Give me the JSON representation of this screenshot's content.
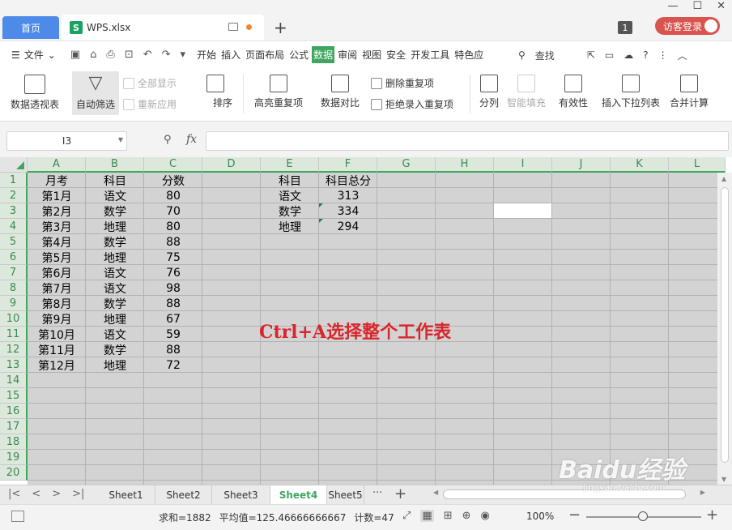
{
  "titlebar": {
    "home_tab": "首页",
    "file_tab": "WPS.xlsx",
    "file_icon": "S",
    "add_tab": "+",
    "badge": "1",
    "login": "访客登录",
    "win_min": "—",
    "win_max": "☐",
    "win_close": "✕"
  },
  "menubar": {
    "file": "文件",
    "tabs": [
      "开始",
      "插入",
      "页面布局",
      "公式",
      "数据",
      "审阅",
      "视图",
      "安全",
      "开发工具",
      "特色应"
    ],
    "active_tab": "数据",
    "search": "查找"
  },
  "ribbon": {
    "pivot": "数据透视表",
    "autofilter": "自动筛选",
    "show_all": "全部显示",
    "reapply": "重新应用",
    "sort": "排序",
    "highlight_dup": "高亮重复项",
    "data_compare": "数据对比",
    "remove_dup": "删除重复项",
    "reject_dup": "拒绝录入重复项",
    "split": "分列",
    "smart_fill": "智能填充",
    "validity": "有效性",
    "insert_dropdown": "插入下拉列表",
    "consolidate": "合并计算"
  },
  "formula": {
    "namebox": "I3",
    "fx": "fx",
    "value": ""
  },
  "grid": {
    "columns": [
      "A",
      "B",
      "C",
      "D",
      "E",
      "F",
      "G",
      "H",
      "I",
      "J",
      "K",
      "L"
    ],
    "rows": [
      "1",
      "2",
      "3",
      "4",
      "5",
      "6",
      "7",
      "8",
      "9",
      "10",
      "11",
      "12",
      "13",
      "14",
      "15",
      "16",
      "17",
      "18",
      "19",
      "20"
    ],
    "table1": {
      "headers": [
        "月考",
        "科目",
        "分数"
      ],
      "rows": [
        [
          "第1月",
          "语文",
          "80"
        ],
        [
          "第2月",
          "数学",
          "70"
        ],
        [
          "第3月",
          "地理",
          "80"
        ],
        [
          "第4月",
          "数学",
          "88"
        ],
        [
          "第5月",
          "地理",
          "75"
        ],
        [
          "第6月",
          "语文",
          "76"
        ],
        [
          "第7月",
          "语文",
          "98"
        ],
        [
          "第8月",
          "数学",
          "88"
        ],
        [
          "第9月",
          "地理",
          "67"
        ],
        [
          "第10月",
          "语文",
          "59"
        ],
        [
          "第11月",
          "数学",
          "88"
        ],
        [
          "第12月",
          "地理",
          "72"
        ]
      ]
    },
    "table2": {
      "headers": [
        "科目",
        "科目总分"
      ],
      "rows": [
        [
          "语文",
          "313"
        ],
        [
          "数学",
          "334"
        ],
        [
          "地理",
          "294"
        ]
      ]
    },
    "annotation": "Ctrl+A选择整个工作表"
  },
  "sheets": {
    "tabs": [
      "Sheet1",
      "Sheet2",
      "Sheet3",
      "Sheet4",
      "Sheet5"
    ],
    "active": "Sheet4",
    "more": "···",
    "add": "+"
  },
  "status": {
    "sum": "求和=1882",
    "avg": "平均值=125.46666666667",
    "count": "计数=47",
    "zoom": "100%"
  },
  "watermark": {
    "main": "Baidu经验",
    "sub": "jingyan.baidu.com"
  },
  "colors": {
    "accent_green": "#3fa55f",
    "home_tab_blue": "#4e8ae8",
    "annotation_red": "#d8262c",
    "login_red": "#d9534f"
  }
}
